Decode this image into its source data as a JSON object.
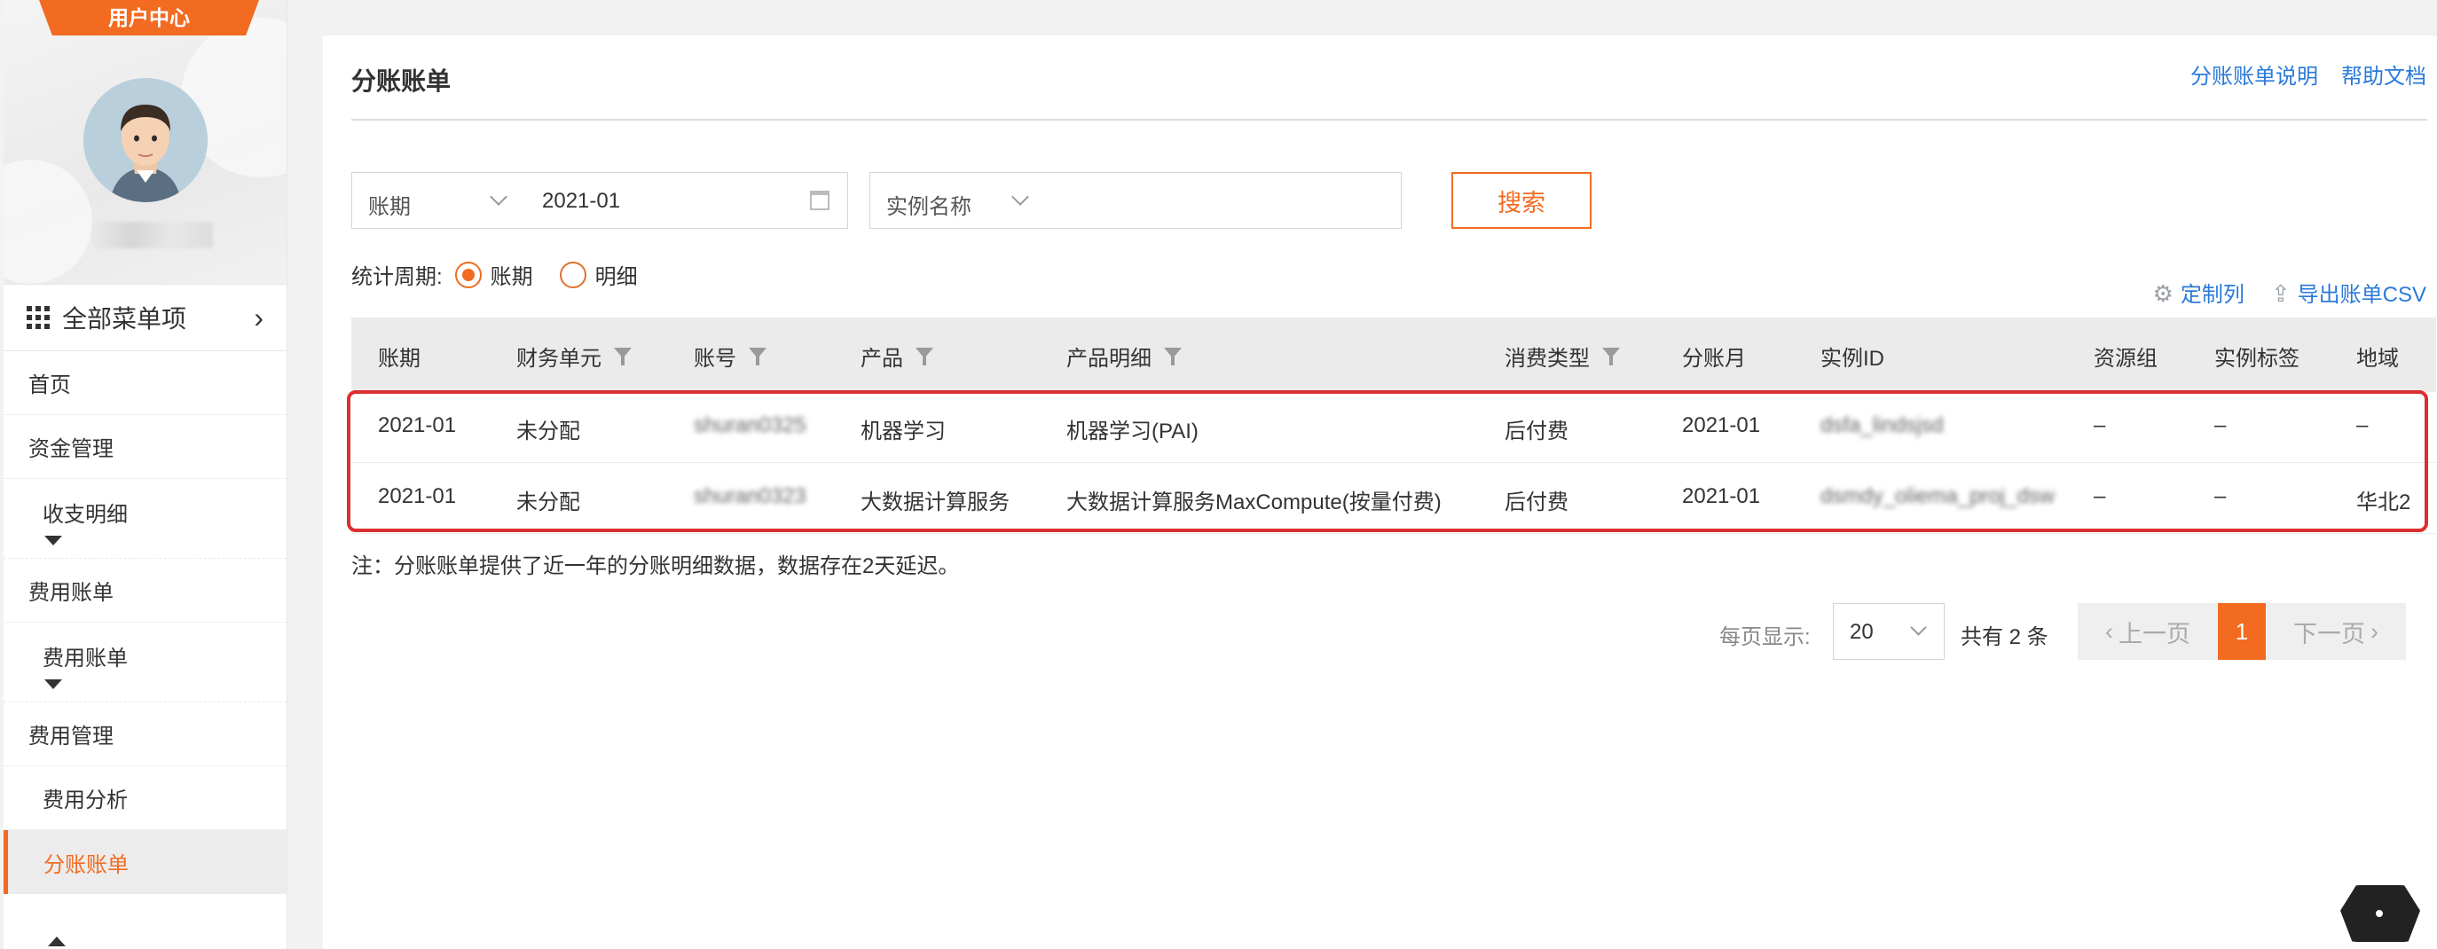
{
  "sidebar": {
    "user_center": "用户中心",
    "all_menu": "全部菜单项",
    "home": "首页",
    "fund_mgmt": "资金管理",
    "income_detail": "收支明细",
    "fee_bill_group": "费用账单",
    "fee_bill": "费用账单",
    "fee_mgmt": "费用管理",
    "fee_analysis": "费用分析",
    "split_bill": "分账账单"
  },
  "header": {
    "title": "分账账单",
    "link_help_split": "分账账单说明",
    "link_help_doc": "帮助文档"
  },
  "filters": {
    "period_select": "账期",
    "period_value": "2021-01",
    "instance_select": "实例名称",
    "search_btn": "搜索"
  },
  "stat_period": {
    "label": "统计周期:",
    "option_period": "账期",
    "option_detail": "明细",
    "selected": "账期"
  },
  "tools": {
    "custom_cols": "定制列",
    "export_csv": "导出账单CSV"
  },
  "table": {
    "headers": [
      "账期",
      "财务单元",
      "账号",
      "产品",
      "产品明细",
      "消费类型",
      "分账月",
      "实例ID",
      "资源组",
      "实例标签",
      "地域"
    ],
    "rows": [
      [
        "2021-01",
        "未分配",
        "shuran0325",
        "机器学习",
        "机器学习(PAI)",
        "后付费",
        "2021-01",
        "dsfa_lindsjsd",
        "–",
        "–",
        "–"
      ],
      [
        "2021-01",
        "未分配",
        "shuran0323",
        "大数据计算服务",
        "大数据计算服务MaxCompute(按量付费)",
        "后付费",
        "2021-01",
        "dsmdy_oliema_proj_dsw",
        "–",
        "–",
        "华北2"
      ]
    ]
  },
  "note": "注：分账账单提供了近一年的分账明细数据，数据存在2天延迟。",
  "pagination": {
    "per_page_label": "每页显示:",
    "per_page": "20",
    "total": "共有 2 条",
    "prev": "上一页",
    "current": "1",
    "next": "下一页"
  },
  "colors": {
    "accent": "#f26b21",
    "link": "#2a7ad8",
    "highlight": "#dc2f2f"
  }
}
